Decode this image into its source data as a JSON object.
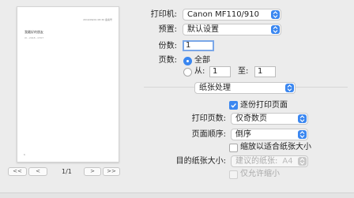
{
  "preview": {
    "header_text": "2019/06/01 08:30  备案号",
    "title": "我最好的朋友",
    "subtitle": "XI - 2018 - 0707",
    "page_number": "1",
    "nav": {
      "first": "<<",
      "prev": "<",
      "next": ">",
      "last": ">>"
    },
    "page_counter": "1/1"
  },
  "printer": {
    "label": "打印机:",
    "value": "Canon MF110/910"
  },
  "presets": {
    "label": "预置:",
    "value": "默认设置"
  },
  "copies": {
    "label": "份数:",
    "value": "1"
  },
  "pages": {
    "label": "页数:",
    "all_label": "全部",
    "from_label": "从:",
    "from_value": "1",
    "to_label": "至:",
    "to_value": "1"
  },
  "section": {
    "value": "纸张处理"
  },
  "collate": {
    "label": "逐份打印页面",
    "checked": true
  },
  "pages_to_print": {
    "label": "打印页数:",
    "value": "仅奇数页"
  },
  "page_order": {
    "label": "页面顺序:",
    "value": "倒序"
  },
  "scale_to_fit": {
    "label": "缩放以适合纸张大小",
    "checked": false
  },
  "destination_paper": {
    "label": "目的纸张大小:",
    "placeholder": "建议的纸张:",
    "value": "A4"
  },
  "scale_down_only": {
    "label": "仅允许缩小",
    "checked": false
  },
  "colors": {
    "accent": "#3b87f0",
    "background": "#ececec"
  }
}
